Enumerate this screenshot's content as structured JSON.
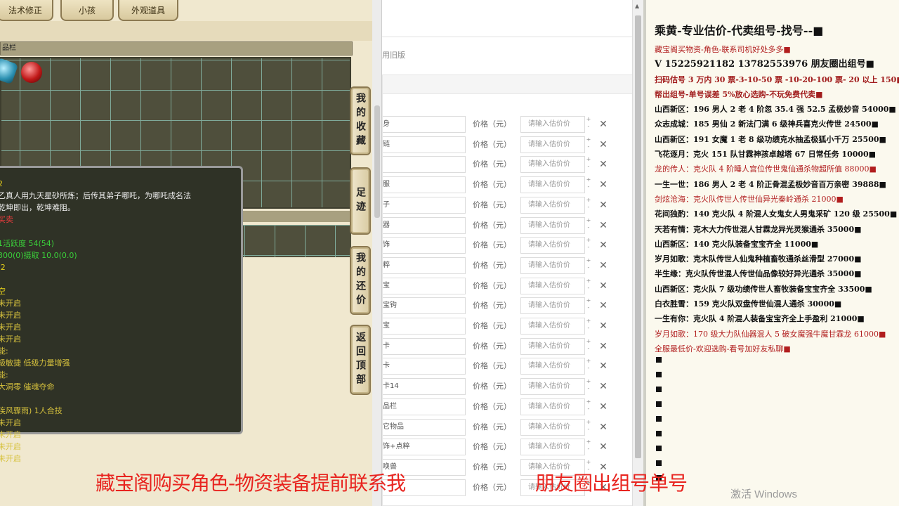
{
  "game": {
    "tabs": [
      "法术修正",
      "小孩",
      "外观道具"
    ],
    "inventory_header": "品栏",
    "side_buttons": [
      "我的收藏",
      "足迹",
      "我的还价",
      "返回顶部"
    ],
    "tooltip_lines": [
      {
        "text": "2",
        "color": "c-yellow"
      },
      {
        "text": "乙真人用九天星砂所炼；后传其弟子哪吒，为哪吒成名法",
        "color": "c-white"
      },
      {
        "text": "乾坤即出，乾坤难阻。",
        "color": "c-white"
      },
      {
        "text": "买卖",
        "color": "c-red"
      },
      {
        "text": "",
        "color": "c-white"
      },
      {
        "text": "  1活跃度     54(54)",
        "color": "c-green"
      },
      {
        "text": "    300(0)摄取    10.0(0.0)",
        "color": "c-green"
      },
      {
        "text": ":2",
        "color": "c-yellow"
      },
      {
        "text": "",
        "color": "c-white"
      },
      {
        "text": "空",
        "color": "c-yellow"
      },
      {
        "text": "未开启",
        "color": "c-yel2"
      },
      {
        "text": "未开启",
        "color": "c-yel2"
      },
      {
        "text": "未开启",
        "color": "c-yel2"
      },
      {
        "text": "未开启",
        "color": "c-yel2"
      },
      {
        "text": "能:",
        "color": "c-yel2"
      },
      {
        "text": "級敏捷      低级力量增强",
        "color": "c-yel2"
      },
      {
        "text": "能:",
        "color": "c-yel2"
      },
      {
        "text": "大洞零     催魂夺命",
        "color": "c-yel2"
      },
      {
        "text": "",
        "color": "c-white"
      },
      {
        "text": "疾风骤雨) 1人合技",
        "color": "c-yel2"
      },
      {
        "text": "未开启",
        "color": "c-yel2"
      },
      {
        "text": "未开启",
        "color": "c-yel2"
      },
      {
        "text": "未开启",
        "color": "c-yel2"
      },
      {
        "text": "未开启",
        "color": "c-yel2"
      }
    ]
  },
  "browser": {
    "old_version_link": "用旧版",
    "price_label": "价格（元）",
    "input_placeholder": "请输入估价价",
    "spin_up": "+",
    "spin_down": "-",
    "delete_icon": "✕",
    "rows": [
      "身",
      "链",
      "",
      "服",
      "子",
      "器",
      "饰",
      "粹",
      "宝",
      "宝钩",
      "宝",
      "卡",
      "卡",
      "卡14",
      "品栏",
      "它物品",
      "饰+点粹",
      "唤兽",
      ""
    ]
  },
  "ad": {
    "title": "乘黄-专业估价-代卖组号-找号--■",
    "lines": [
      {
        "text": "藏宝阁买物资-角色-联系司机好处多多■",
        "cls": "red"
      },
      {
        "text": "V 15225921182   13782553976  朋友圈出组号■",
        "cls": "big"
      },
      {
        "text": "扫码估号 3 万内 30 票-3-10-50 票  -10-20-100 票- 20 以上 150■",
        "cls": "red2"
      },
      {
        "text": "帮出组号-单号误差 5%放心选购-不玩免费代卖■",
        "cls": "red2"
      },
      {
        "text": "山西新区：196 男人 2 老 4 阶忽 35.4 强 52.5 孟极妙音 54000■",
        "cls": ""
      },
      {
        "text": "众志成城：185 男仙 2 新法门满 6 级神兵喜克火传世 24500■",
        "cls": ""
      },
      {
        "text": "山西新区：191 女魔 1 老 8 级功绩克水抽孟极狐小千万 25500■",
        "cls": ""
      },
      {
        "text": "飞花逐月：克火 151 队甘霖神孩卓越塔 67 日常任务 10000■",
        "cls": ""
      },
      {
        "text": "龙的传人：克火队 4 阶睡人宫位传世鬼仙通杀物超所值 88000■",
        "cls": "red"
      },
      {
        "text": "一生一世：186 男人 2 老 4 阶正骨混孟极妙音百万亲密 39888■",
        "cls": ""
      },
      {
        "text": "剑炫沧海：克火队传世人传世仙异光秦岭通杀 21000■",
        "cls": "red"
      },
      {
        "text": "花间独酌：140 克火队 4 阶混人女鬼女人男鬼采矿 120 级 25500■",
        "cls": ""
      },
      {
        "text": "天若有情：克木大力传世混人甘霖龙异光灵猴通杀 35000■",
        "cls": ""
      },
      {
        "text": "山西新区：140 克火队装备宝宝齐全 11000■",
        "cls": ""
      },
      {
        "text": "岁月如歌：克木队传世人仙鬼种植畜牧通杀丝滑型 27000■",
        "cls": ""
      },
      {
        "text": "半生缘：克火队传世混人传世仙品像较好异光通杀 35000■",
        "cls": ""
      },
      {
        "text": "山西新区：克火队 7 级功绩传世人畜牧装备宝宝齐全 33500■",
        "cls": ""
      },
      {
        "text": "白衣胜雪：159 克火队双盘传世仙混人通杀 30000■",
        "cls": ""
      },
      {
        "text": "一生有你：克火队 4 阶混人装备宝宝齐全上手盈利 21000■",
        "cls": ""
      },
      {
        "text": "岁月如歌：170 级大力队仙器混人 5 破女魔强牛魔甘霖龙 61000■",
        "cls": "red"
      },
      {
        "text": "全服最低价-欢迎选购-看号加好友私聊■",
        "cls": "red"
      }
    ],
    "bullet_count": 9
  },
  "overlay": {
    "banner_left": "藏宝阁购买角色-物资装备提前联系我",
    "banner_right": "朋友圈出组号单号",
    "watermark": "激活 Windows"
  }
}
